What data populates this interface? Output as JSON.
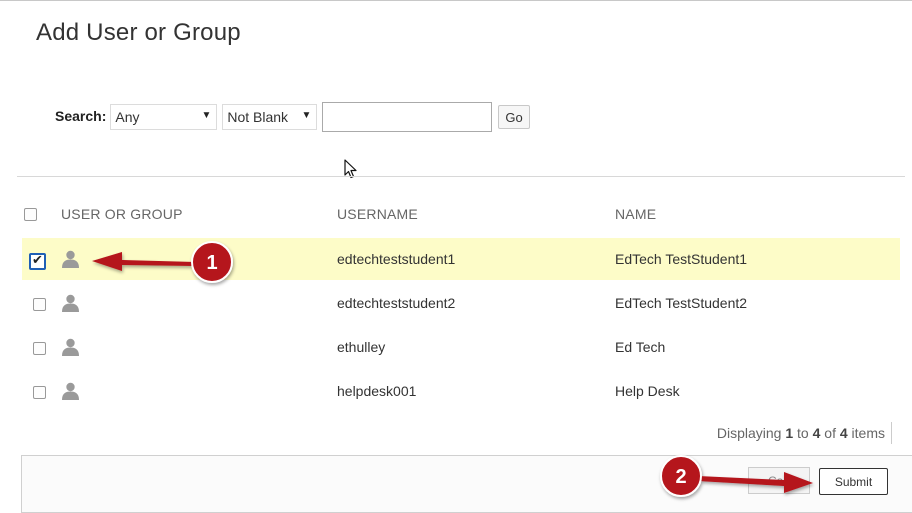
{
  "page": {
    "title": "Add User or Group"
  },
  "search": {
    "label": "Search:",
    "field_select": "Any",
    "condition_select": "Not Blank",
    "input_value": "",
    "go_label": "Go"
  },
  "table": {
    "columns": [
      "USER OR GROUP",
      "USERNAME",
      "NAME"
    ],
    "rows": [
      {
        "username": "edtechteststudent1",
        "name": "EdTech TestStudent1",
        "checked": true
      },
      {
        "username": "edtechteststudent2",
        "name": "EdTech TestStudent2",
        "checked": false
      },
      {
        "username": "ethulley",
        "name": "Ed Tech",
        "checked": false
      },
      {
        "username": "helpdesk001",
        "name": "Help Desk",
        "checked": false
      }
    ]
  },
  "pager": {
    "prefix": "Displaying",
    "start": "1",
    "to": "to",
    "end": "4",
    "of": "of",
    "total": "4",
    "suffix": "items"
  },
  "footer": {
    "cancel_label": "Can",
    "submit_label": "Submit"
  },
  "annotations": {
    "step1": "1",
    "step2": "2",
    "arrow_color": "#b5121b"
  },
  "colors": {
    "selected_row": "#fdfcc8",
    "checkbox_border_checked": "#1f5fb5"
  }
}
